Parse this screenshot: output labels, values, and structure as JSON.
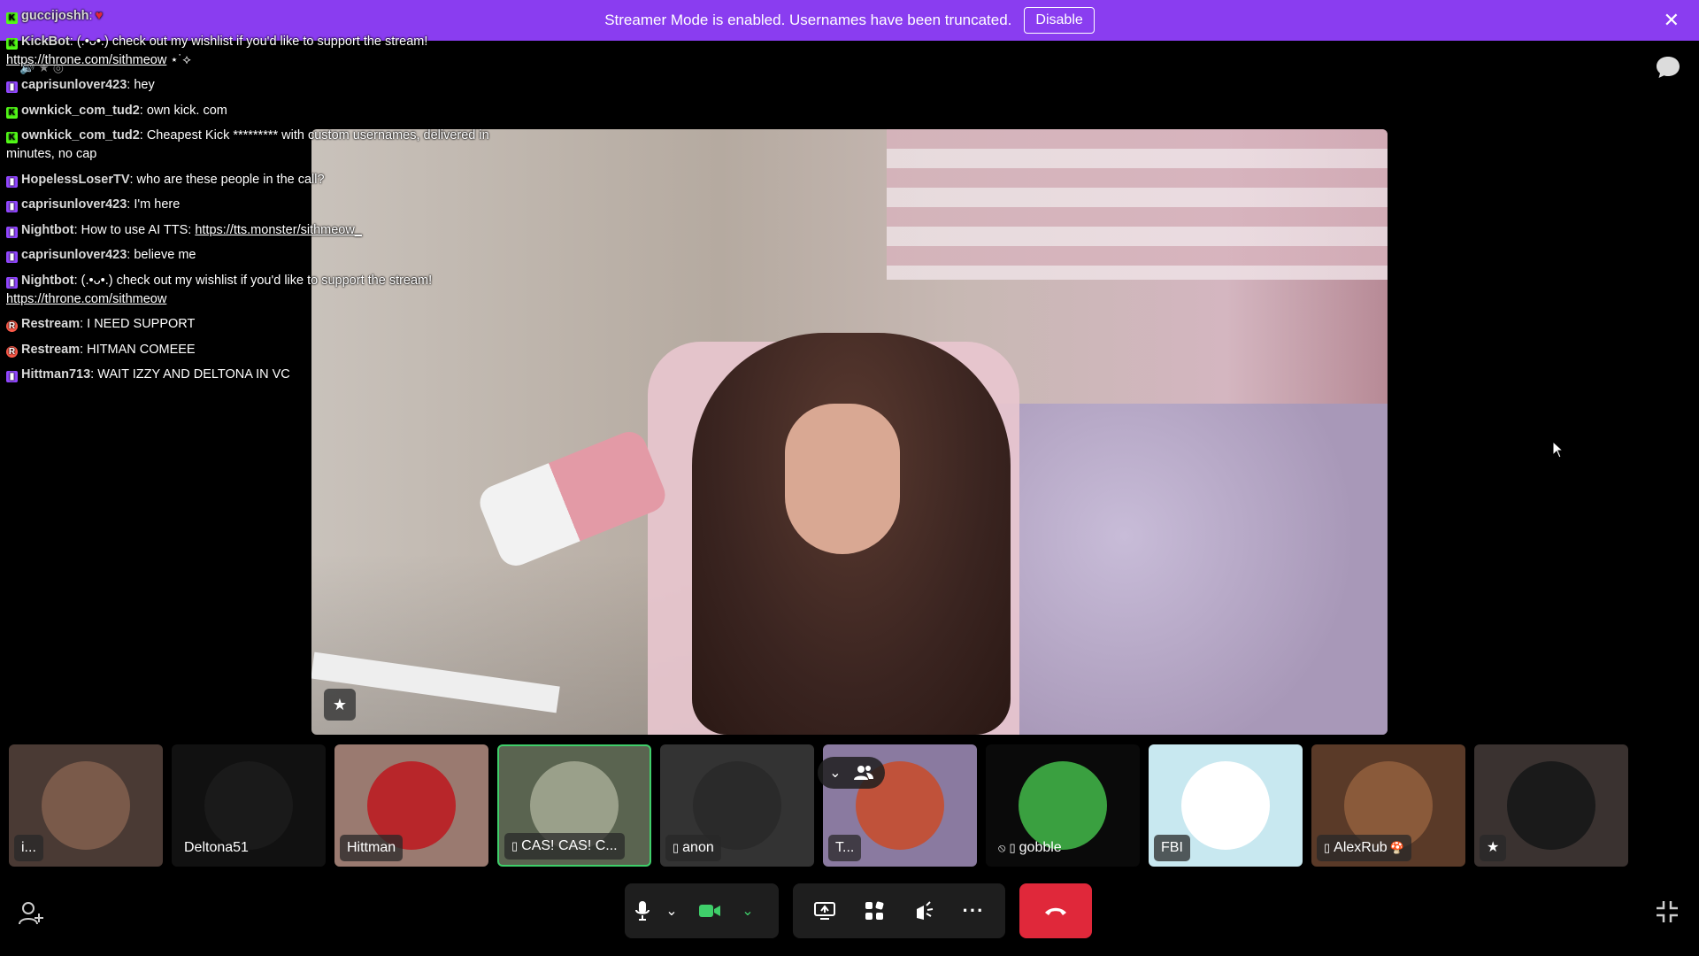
{
  "banner": {
    "text": "Streamer Mode is enabled. Usernames have been truncated.",
    "button_label": "Disable",
    "color": "#8a3df0"
  },
  "chat": {
    "messages": [
      {
        "platform": "kick",
        "user": "guccijoshh",
        "text": ":",
        "emoji": "♥"
      },
      {
        "platform": "kick",
        "user": "KickBot",
        "text": ": (.•ᴗ•.) check out my wishlist if you'd like to support the stream!",
        "link": "https://throne.com/sithmeow",
        "suffix": " ⋆˙⟡"
      },
      {
        "platform": "twitch",
        "user": "caprisunlover423",
        "text": ": hey"
      },
      {
        "platform": "kick",
        "user": "ownkick_com_tud2",
        "text": ": own kick. com"
      },
      {
        "platform": "kick",
        "user": "ownkick_com_tud2",
        "text": ": Cheapest Kick ********* with custom usernames, delivered in minutes, no cap"
      },
      {
        "platform": "twitch",
        "user": "HopelessLoserTV",
        "text": ": who are these people in the call?"
      },
      {
        "platform": "twitch",
        "user": "caprisunlover423",
        "text": ": I'm here"
      },
      {
        "platform": "twitch",
        "user": "Nightbot",
        "text": ": How to use AI TTS: ",
        "link": "https://tts.monster/sithmeow_"
      },
      {
        "platform": "twitch",
        "user": "caprisunlover423",
        "text": ": believe me"
      },
      {
        "platform": "twitch",
        "user": "Nightbot",
        "text": ": (.•ᴗ•.) check out my wishlist if you'd like to support the stream!",
        "link": "https://throne.com/sithmeow"
      },
      {
        "platform": "restream",
        "user": "Restream",
        "text": ": I NEED SUPPORT"
      },
      {
        "platform": "restream",
        "user": "Restream",
        "text": ": HITMAN COMEEE"
      },
      {
        "platform": "twitch",
        "user": "Hittman713",
        "text": ": WAIT IZZY AND DELTONA IN VC"
      }
    ]
  },
  "participants": [
    {
      "label": "i...",
      "has_phone": false,
      "avatar_color": "#7a5a4a",
      "bg": "#4a3a34",
      "plain": false
    },
    {
      "label": "Deltona51",
      "has_phone": false,
      "avatar_color": "#1a1a1a",
      "bg": "#111111",
      "plain": true
    },
    {
      "label": "Hittman",
      "has_phone": false,
      "avatar_color": "#b8262a",
      "bg": "#9a7a70",
      "plain": false
    },
    {
      "label": "CAS! CAS! C...",
      "has_phone": true,
      "avatar_color": "#9aa08a",
      "bg": "#5a6450",
      "plain": false,
      "active": true
    },
    {
      "label": "anon",
      "has_phone": true,
      "avatar_color": "#2a2a2a",
      "bg": "#333333",
      "plain": false
    },
    {
      "label": "T...",
      "has_phone": false,
      "avatar_color": "#c0523a",
      "bg": "#8a7aa0",
      "plain": false
    },
    {
      "label": "gobble",
      "has_phone": true,
      "muted": true,
      "avatar_color": "#3aa040",
      "bg": "#0a0a0a",
      "plain": true
    },
    {
      "label": "FBI",
      "has_phone": false,
      "avatar_color": "#ffffff",
      "bg": "#c8e8f0",
      "plain": false
    },
    {
      "label": "AlexRub",
      "has_phone": true,
      "avatar_color": "#8a5a3a",
      "bg": "#5a3a28",
      "plain": false,
      "emoji": "🍄"
    },
    {
      "label": "★",
      "has_phone": false,
      "avatar_color": "#1a1a1a",
      "bg": "#3a3230",
      "plain": false
    }
  ],
  "toolbar": {
    "mic_icon": "microphone-icon",
    "camera_icon": "camera-icon",
    "share_icon": "screen-share-icon",
    "activities_icon": "activities-icon",
    "soundboard_icon": "soundboard-icon",
    "more_icon": "more-icon",
    "hangup_icon": "hang-up-icon",
    "camera_color": "#3fcf6a",
    "hangup_color": "#e0283a"
  }
}
